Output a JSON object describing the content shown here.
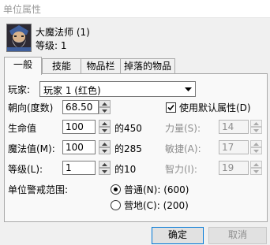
{
  "window": {
    "title": "单位属性"
  },
  "unit": {
    "name": "大魔法师 (1)",
    "level": "等级: 1"
  },
  "tabs": [
    {
      "label": "一般"
    },
    {
      "label": "技能"
    },
    {
      "label": "物品栏"
    },
    {
      "label": "掉落的物品"
    }
  ],
  "general": {
    "player_label": "玩家:",
    "player_value": "玩家 1 (红色)",
    "facing_label": "朝向(度数)",
    "facing_value": "68.50",
    "use_default_label": "使用默认属性(D)",
    "use_default_checked": true,
    "life_label": "生命值",
    "life_value": "100",
    "life_of": "的450",
    "mana_label": "魔法值(M):",
    "mana_value": "100",
    "mana_of": "的285",
    "level_label": "等级(L):",
    "level_value": "1",
    "level_of": "的10",
    "strength_label": "力量(S):",
    "strength_value": "14",
    "agility_label": "敏捷(A):",
    "agility_value": "17",
    "intelligence_label": "智力(I):",
    "intelligence_value": "19",
    "alert_range_label": "单位警戒范围:",
    "alert_normal_label": "普通(N): (600)",
    "alert_camp_label": "营地(C): (200)",
    "alert_selected": "normal"
  },
  "buttons": {
    "ok": "确定",
    "cancel": "取消"
  },
  "colors": {
    "accent": "#0078d7",
    "disabled_text": "#8d8d8d",
    "border": "#a9a9a9"
  }
}
